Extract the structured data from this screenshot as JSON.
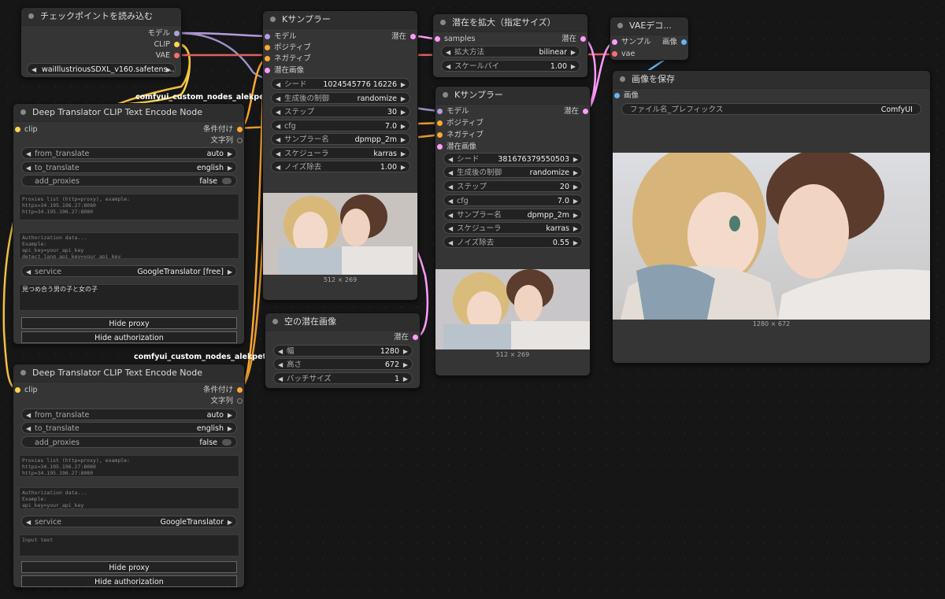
{
  "colors": {
    "canvas": "#161616",
    "node_bg": "#353535",
    "model": "#b39ddb",
    "clip": "#ffd54f",
    "vae": "#ff6e6e",
    "conditioning": "#ffa931",
    "latent": "#ff9cf9",
    "image": "#64b5f6"
  },
  "checkpoint": {
    "title": "チェックポイントを読み込む",
    "outputs": {
      "model": "モデル",
      "clip": "CLIP",
      "vae": "VAE"
    },
    "ckpt_name": "waiIllustriousSDXL_v160.safetens..."
  },
  "translator1": {
    "tag": "comfyui_custom_nodes_alekpet",
    "title": "Deep Translator CLIP Text Encode Node",
    "input_clip": "clip",
    "out_cond": "条件付け",
    "out_str": "文字列",
    "from_translate_label": "from_translate",
    "from_translate_value": "auto",
    "to_translate_label": "to_translate",
    "to_translate_value": "english",
    "add_proxies_label": "add_proxies",
    "add_proxies_value": "false",
    "proxies_text": "Proxies list (http=proxy), example:\nhttps=34.195.196.27:8080\nhttp=34.195.196.27:8080",
    "auth_text": "Authorization data...\nExample:\napi_key=your_api_key\ndetect_lang_api_key=your_api_key",
    "service_label": "service",
    "service_value": "GoogleTranslator [free]",
    "prompt_text": "見つめ合う男の子と女の子",
    "hide_proxy": "Hide proxy",
    "hide_auth": "Hide authorization"
  },
  "translator2": {
    "tag": "comfyui_custom_nodes_alekpet",
    "title": "Deep Translator CLIP Text Encode Node",
    "input_clip": "clip",
    "out_cond": "条件付け",
    "out_str": "文字列",
    "from_translate_label": "from_translate",
    "from_translate_value": "auto",
    "to_translate_label": "to_translate",
    "to_translate_value": "english",
    "add_proxies_label": "add_proxies",
    "add_proxies_value": "false",
    "proxies_text": "Proxies list (http=proxy), example:\nhttps=34.195.196.27:8080\nhttp=34.195.196.27:8080",
    "auth_text": "Authorization data...\nExample:\napi_key=your_api_key\ndetect_lang_api_key=your_api_key",
    "service_label": "service",
    "service_value": "GoogleTranslator",
    "prompt_placeholder": "Input text",
    "hide_proxy": "Hide proxy",
    "hide_auth": "Hide authorization"
  },
  "ksampler1": {
    "title": "Kサンプラー",
    "inputs": [
      "モデル",
      "ポジティブ",
      "ネガティブ",
      "潜在画像"
    ],
    "output": "潜在",
    "widgets": [
      {
        "label": "シード",
        "value": "1024545776 16226"
      },
      {
        "label": "生成後の制御",
        "value": "randomize"
      },
      {
        "label": "ステップ",
        "value": "30"
      },
      {
        "label": "cfg",
        "value": "7.0"
      },
      {
        "label": "サンプラー名",
        "value": "dpmpp_2m"
      },
      {
        "label": "スケジューラ",
        "value": "karras"
      },
      {
        "label": "ノイズ除去",
        "value": "1.00"
      }
    ],
    "preview_size": "512 × 269"
  },
  "empty_latent": {
    "title": "空の潜在画像",
    "output": "潜在",
    "widgets": [
      {
        "label": "幅",
        "value": "1280"
      },
      {
        "label": "高さ",
        "value": "672"
      },
      {
        "label": "バッチサイズ",
        "value": "1"
      }
    ]
  },
  "upscale": {
    "title": "潜在を拡大（指定サイズ）",
    "input": "samples",
    "output": "潜在",
    "widgets": [
      {
        "label": "拡大方法",
        "value": "bilinear"
      },
      {
        "label": "スケールバイ",
        "value": "1.00"
      }
    ]
  },
  "ksampler2": {
    "title": "Kサンプラー",
    "inputs": [
      "モデル",
      "ポジティブ",
      "ネガティブ",
      "潜在画像"
    ],
    "output": "潜在",
    "widgets": [
      {
        "label": "シード",
        "value": "381676379550503"
      },
      {
        "label": "生成後の制御",
        "value": "randomize"
      },
      {
        "label": "ステップ",
        "value": "20"
      },
      {
        "label": "cfg",
        "value": "7.0"
      },
      {
        "label": "サンプラー名",
        "value": "dpmpp_2m"
      },
      {
        "label": "スケジューラ",
        "value": "karras"
      },
      {
        "label": "ノイズ除去",
        "value": "0.55"
      }
    ],
    "preview_size": "512 × 269"
  },
  "vae_decode": {
    "title": "VAEデコ...",
    "inputs": [
      "サンプル",
      "vae"
    ],
    "output": "画像"
  },
  "save_image": {
    "title": "画像を保存",
    "input": "画像",
    "prefix_label": "ファイル名_プレフィックス",
    "prefix_value": "ComfyUI",
    "image_size": "1280 × 672"
  }
}
